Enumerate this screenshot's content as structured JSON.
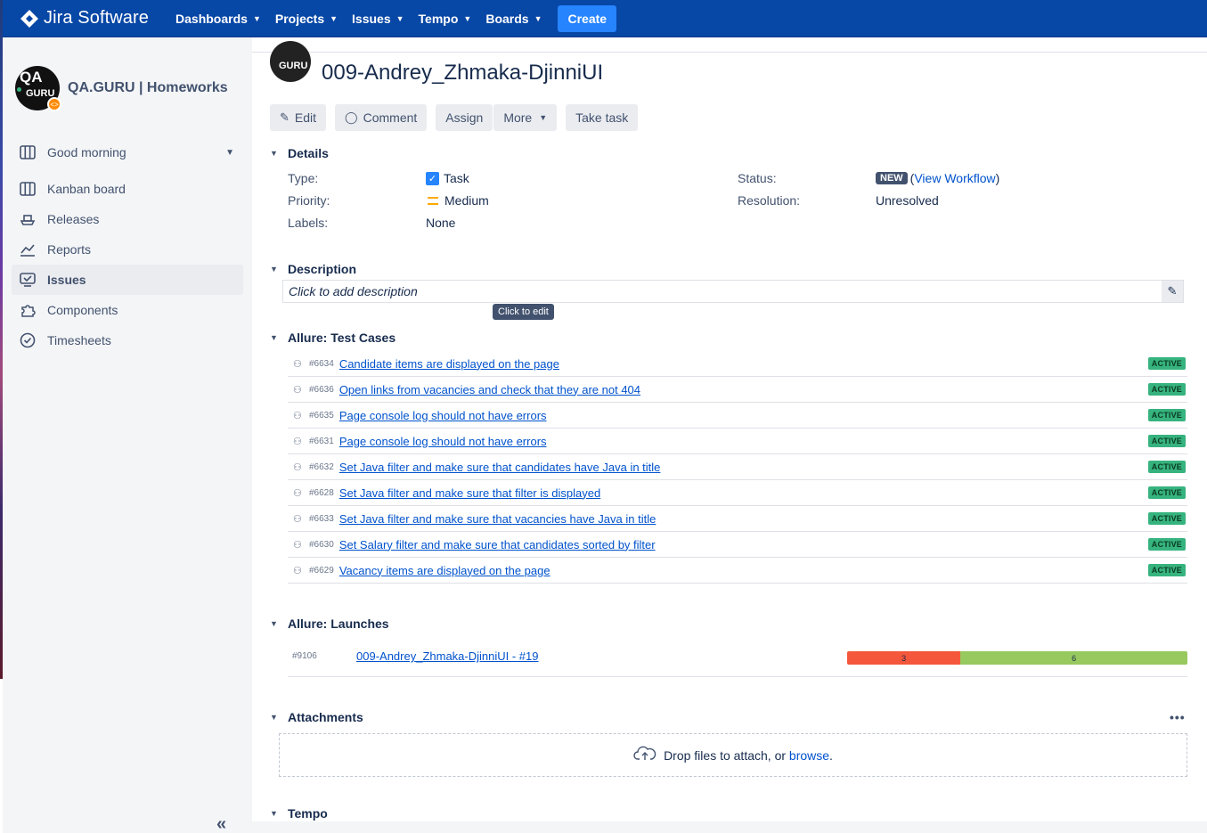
{
  "app": {
    "name": "Jira Software"
  },
  "nav": {
    "items": [
      {
        "label": "Dashboards"
      },
      {
        "label": "Projects"
      },
      {
        "label": "Issues"
      },
      {
        "label": "Tempo"
      },
      {
        "label": "Boards"
      }
    ],
    "create_label": "Create"
  },
  "sidebar": {
    "project_name": "QA.GURU | Homeworks",
    "project_avatar_text_top": "QA",
    "project_avatar_text_bottom": "GURU",
    "board_selector": "Good morning",
    "items": [
      {
        "label": "Kanban board",
        "icon": "board-icon"
      },
      {
        "label": "Releases",
        "icon": "ship-icon"
      },
      {
        "label": "Reports",
        "icon": "chart-icon"
      },
      {
        "label": "Issues",
        "icon": "issues-icon",
        "active": true
      },
      {
        "label": "Components",
        "icon": "puzzle-icon"
      },
      {
        "label": "Timesheets",
        "icon": "clock-icon"
      }
    ],
    "collapse_glyph": "«"
  },
  "issue": {
    "avatar_text": "GURU",
    "title": "009-Andrey_Zhmaka-DjinniUI"
  },
  "toolbar": {
    "edit": "Edit",
    "comment": "Comment",
    "assign": "Assign",
    "more": "More",
    "take_task": "Take task"
  },
  "details": {
    "heading": "Details",
    "type_label": "Type:",
    "type_value": "Task",
    "priority_label": "Priority:",
    "priority_value": "Medium",
    "labels_label": "Labels:",
    "labels_value": "None",
    "status_label": "Status:",
    "status_value": "NEW",
    "status_link": "View Workflow",
    "resolution_label": "Resolution:",
    "resolution_value": "Unresolved",
    "colors": {
      "priority": "#ffab00",
      "checkbox": "#2684ff"
    }
  },
  "description": {
    "heading": "Description",
    "placeholder": "Click to add description",
    "tooltip": "Click to edit"
  },
  "test_cases": {
    "heading": "Allure: Test Cases",
    "items": [
      {
        "id": "#6634",
        "name": "Candidate items are displayed on the page",
        "status": "ACTIVE"
      },
      {
        "id": "#6636",
        "name": "Open links from vacancies and check that they are not 404",
        "status": "ACTIVE"
      },
      {
        "id": "#6635",
        "name": "Page console log should not have errors",
        "status": "ACTIVE"
      },
      {
        "id": "#6631",
        "name": "Page console log should not have errors",
        "status": "ACTIVE"
      },
      {
        "id": "#6632",
        "name": "Set Java filter and make sure that candidates have Java in title",
        "status": "ACTIVE"
      },
      {
        "id": "#6628",
        "name": "Set Java filter and make sure that filter is displayed",
        "status": "ACTIVE"
      },
      {
        "id": "#6633",
        "name": "Set Java filter and make sure that vacancies have Java in title",
        "status": "ACTIVE"
      },
      {
        "id": "#6630",
        "name": "Set Salary filter and make sure that candidates sorted by filter",
        "status": "ACTIVE"
      },
      {
        "id": "#6629",
        "name": "Vacancy items are displayed on the page",
        "status": "ACTIVE"
      }
    ]
  },
  "launches": {
    "heading": "Allure: Launches",
    "items": [
      {
        "id": "#9106",
        "name": "009-Andrey_Zhmaka-DjinniUI - #19",
        "failed": 3,
        "passed": 6
      }
    ],
    "colors": {
      "failed": "#f4573b",
      "passed": "#97c95f"
    }
  },
  "attachments": {
    "heading": "Attachments",
    "drop_text": "Drop files to attach, or",
    "browse_link": "browse",
    "drop_suffix": ".",
    "menu_glyph": "•••"
  },
  "tempo": {
    "heading": "Tempo"
  }
}
